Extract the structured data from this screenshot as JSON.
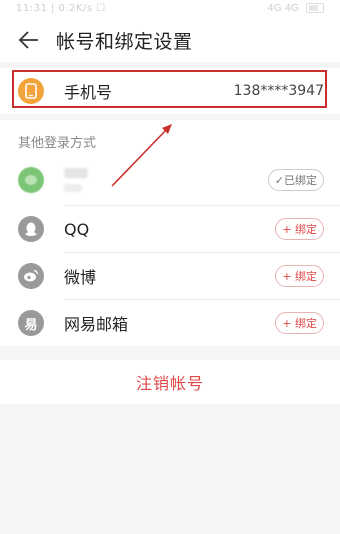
{
  "statusbar": {
    "left": "11:31 | 0.2K/s ☐",
    "right": "4G 4G"
  },
  "header": {
    "title": "帐号和绑定设置"
  },
  "phone": {
    "label": "手机号",
    "value": "138****3947"
  },
  "other_login": {
    "section_label": "其他登录方式",
    "wechat": {
      "status": "✓已绑定"
    },
    "qq": {
      "label": "QQ",
      "action": "+ 绑定"
    },
    "weibo": {
      "label": "微博",
      "action": "+ 绑定"
    },
    "netease": {
      "label": "网易邮箱",
      "action": "+ 绑定"
    }
  },
  "logout": {
    "label": "注销帐号"
  },
  "colors": {
    "accent_red": "#e24848",
    "phone_orange": "#f2a33a",
    "wechat_green": "#7cc576",
    "icon_gray": "#9a9a9a"
  },
  "icons": {
    "back": "arrow-left-icon",
    "phone": "smartphone-icon",
    "wechat": "wechat-icon",
    "qq": "qq-penguin-icon",
    "weibo": "weibo-icon",
    "netease": "netease-mail-icon"
  }
}
